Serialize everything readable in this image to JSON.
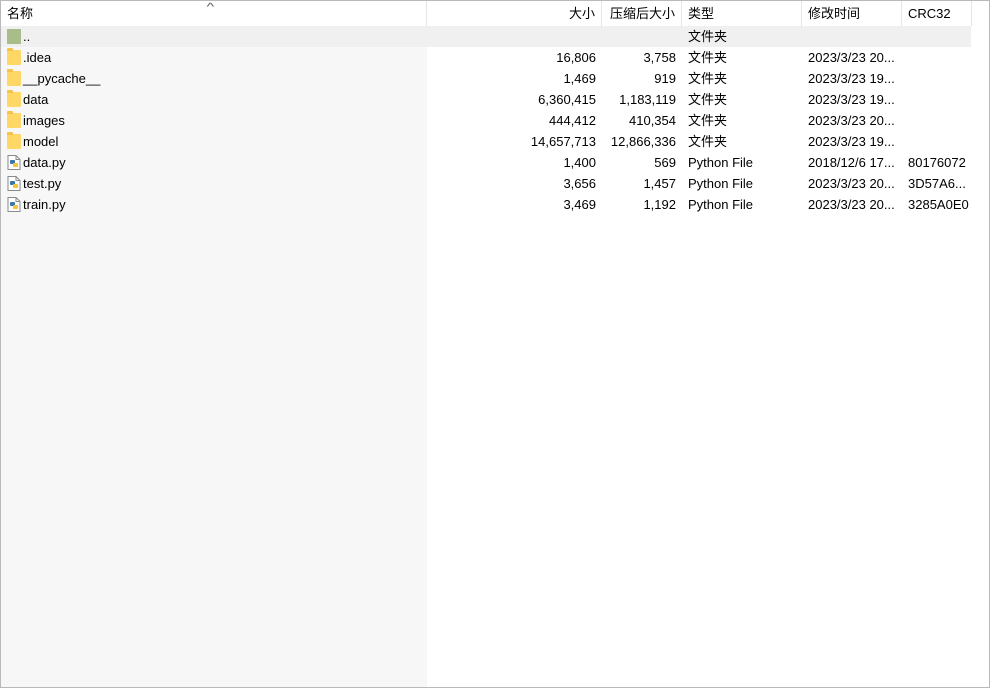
{
  "columns": {
    "name": "名称",
    "size": "大小",
    "packed": "压缩后大小",
    "type": "类型",
    "modified": "修改时间",
    "crc": "CRC32"
  },
  "rows": [
    {
      "name": "..",
      "size": "",
      "packed": "",
      "type": "文件夹",
      "modified": "",
      "crc": "",
      "icon": "parent-folder-icon"
    },
    {
      "name": ".idea",
      "size": "16,806",
      "packed": "3,758",
      "type": "文件夹",
      "modified": "2023/3/23 20...",
      "crc": "",
      "icon": "folder-icon"
    },
    {
      "name": "__pycache__",
      "size": "1,469",
      "packed": "919",
      "type": "文件夹",
      "modified": "2023/3/23 19...",
      "crc": "",
      "icon": "folder-icon"
    },
    {
      "name": "data",
      "size": "6,360,415",
      "packed": "1,183,119",
      "type": "文件夹",
      "modified": "2023/3/23 19...",
      "crc": "",
      "icon": "folder-icon"
    },
    {
      "name": "images",
      "size": "444,412",
      "packed": "410,354",
      "type": "文件夹",
      "modified": "2023/3/23 20...",
      "crc": "",
      "icon": "folder-icon"
    },
    {
      "name": "model",
      "size": "14,657,713",
      "packed": "12,866,336",
      "type": "文件夹",
      "modified": "2023/3/23 19...",
      "crc": "",
      "icon": "folder-icon"
    },
    {
      "name": "data.py",
      "size": "1,400",
      "packed": "569",
      "type": "Python File",
      "modified": "2018/12/6 17...",
      "crc": "80176072",
      "icon": "python-file-icon"
    },
    {
      "name": "test.py",
      "size": "3,656",
      "packed": "1,457",
      "type": "Python File",
      "modified": "2023/3/23 20...",
      "crc": "3D57A6...",
      "icon": "python-file-icon"
    },
    {
      "name": "train.py",
      "size": "3,469",
      "packed": "1,192",
      "type": "Python File",
      "modified": "2023/3/23 20...",
      "crc": "3285A0E0",
      "icon": "python-file-icon"
    }
  ]
}
